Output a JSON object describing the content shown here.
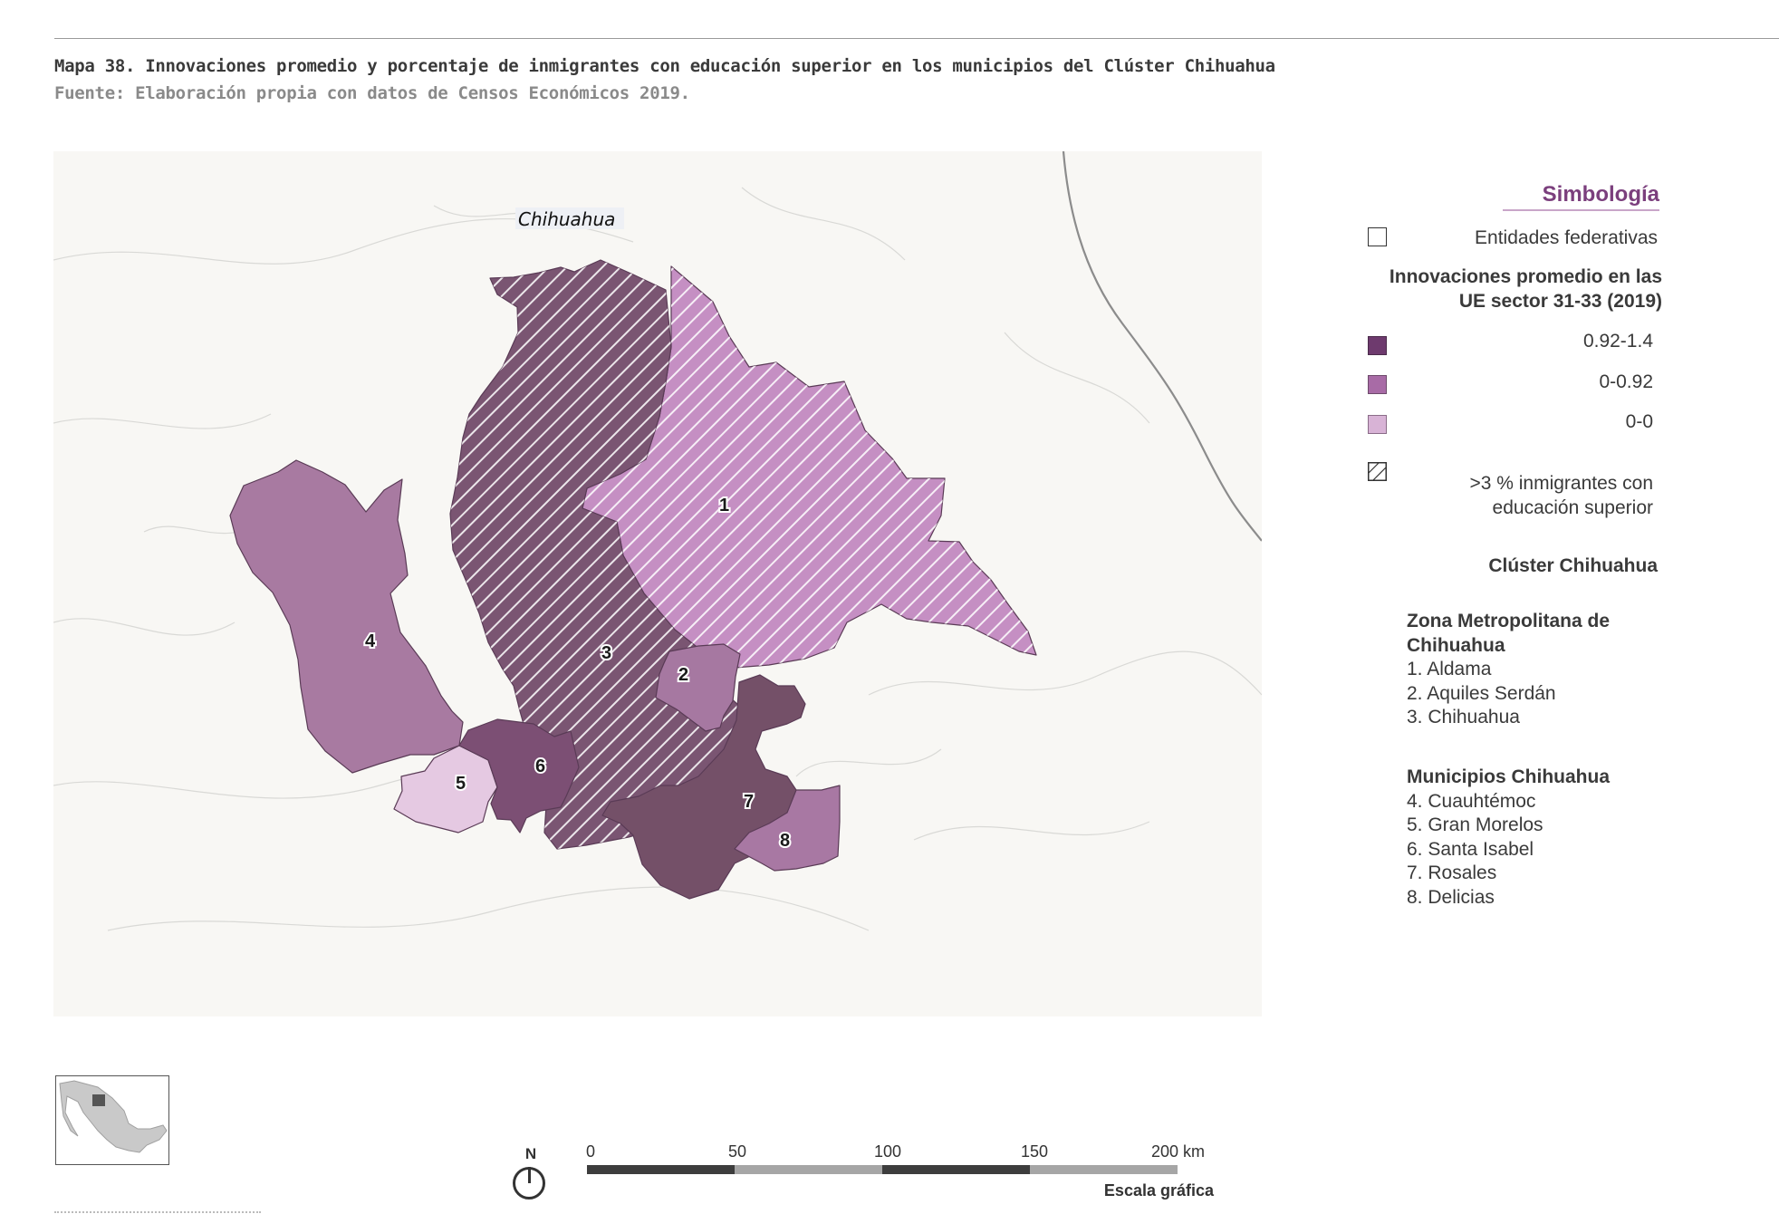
{
  "caption": {
    "title": "Mapa 38. Innovaciones promedio y porcentaje de inmigrantes con educación superior en los municipios del Clúster Chihuahua",
    "source": "Fuente: Elaboración propia con datos de Censos Económicos 2019."
  },
  "map": {
    "state_label": "Chihuahua",
    "municipalities": [
      {
        "id": "1",
        "name": "Aldama",
        "class": "0-0.92",
        "hatched": true
      },
      {
        "id": "2",
        "name": "Aquiles Serdán",
        "class": "0-0.92",
        "hatched": false
      },
      {
        "id": "3",
        "name": "Chihuahua",
        "class": "0.92-1.4",
        "hatched": true
      },
      {
        "id": "4",
        "name": "Cuauhtémoc",
        "class": "0-0.92",
        "hatched": false
      },
      {
        "id": "5",
        "name": "Gran Morelos",
        "class": "0-0",
        "hatched": false
      },
      {
        "id": "6",
        "name": "Santa Isabel",
        "class": "0.92-1.4",
        "hatched": false
      },
      {
        "id": "7",
        "name": "Rosales",
        "class": "0.92-1.4",
        "hatched": false
      },
      {
        "id": "8",
        "name": "Delicias",
        "class": "0-0.92",
        "hatched": false
      }
    ]
  },
  "legend": {
    "title": "Simbología",
    "entidades_label": "Entidades federativas",
    "innovaciones_heading": "Innovaciones promedio en las UE sector 31-33 (2019)",
    "classes": [
      {
        "label": "0.92-1.4",
        "color": "#6e3a6e"
      },
      {
        "label": "0-0.92",
        "color": "#a86ba6"
      },
      {
        "label": "0-0",
        "color": "#d8b3d6"
      }
    ],
    "hatch_label": ">3 % inmigrantes con educación superior",
    "cluster_heading": "Clúster Chihuahua",
    "groups": [
      {
        "heading": "Zona Metropolitana de Chihuahua",
        "items": [
          "1. Aldama",
          "2. Aquiles Serdán",
          "3. Chihuahua"
        ]
      },
      {
        "heading": "Municipios Chihuahua",
        "items": [
          "4. Cuauhtémoc",
          "5. Gran Morelos",
          "6. Santa Isabel",
          "7. Rosales",
          "8. Delicias"
        ]
      }
    ]
  },
  "north_arrow": {
    "label": "N"
  },
  "scale_bar": {
    "ticks": [
      "0",
      "50",
      "100",
      "150",
      "200 km"
    ],
    "caption": "Escala gráfica"
  }
}
